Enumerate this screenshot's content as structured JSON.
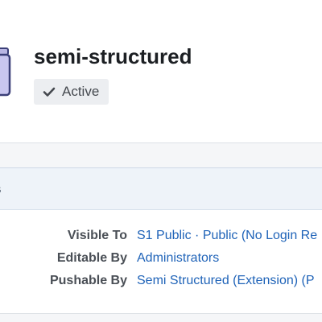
{
  "header": {
    "title": "semi-structured",
    "status": {
      "icon": "check-icon",
      "label": "Active"
    },
    "app_icon": "application-icon"
  },
  "panel": {
    "title_fragment": "s",
    "rows": [
      {
        "label": "Visible To",
        "value": "S1 Public · Public (No Login Re"
      },
      {
        "label": "Editable By",
        "value": "Administrators"
      },
      {
        "label": "Pushable By",
        "value": "Semi Structured (Extension) (P"
      }
    ]
  },
  "colors": {
    "link": "#1f63b8",
    "badge_bg": "#eceef1",
    "panel_header_bg": "#eef3f9"
  }
}
